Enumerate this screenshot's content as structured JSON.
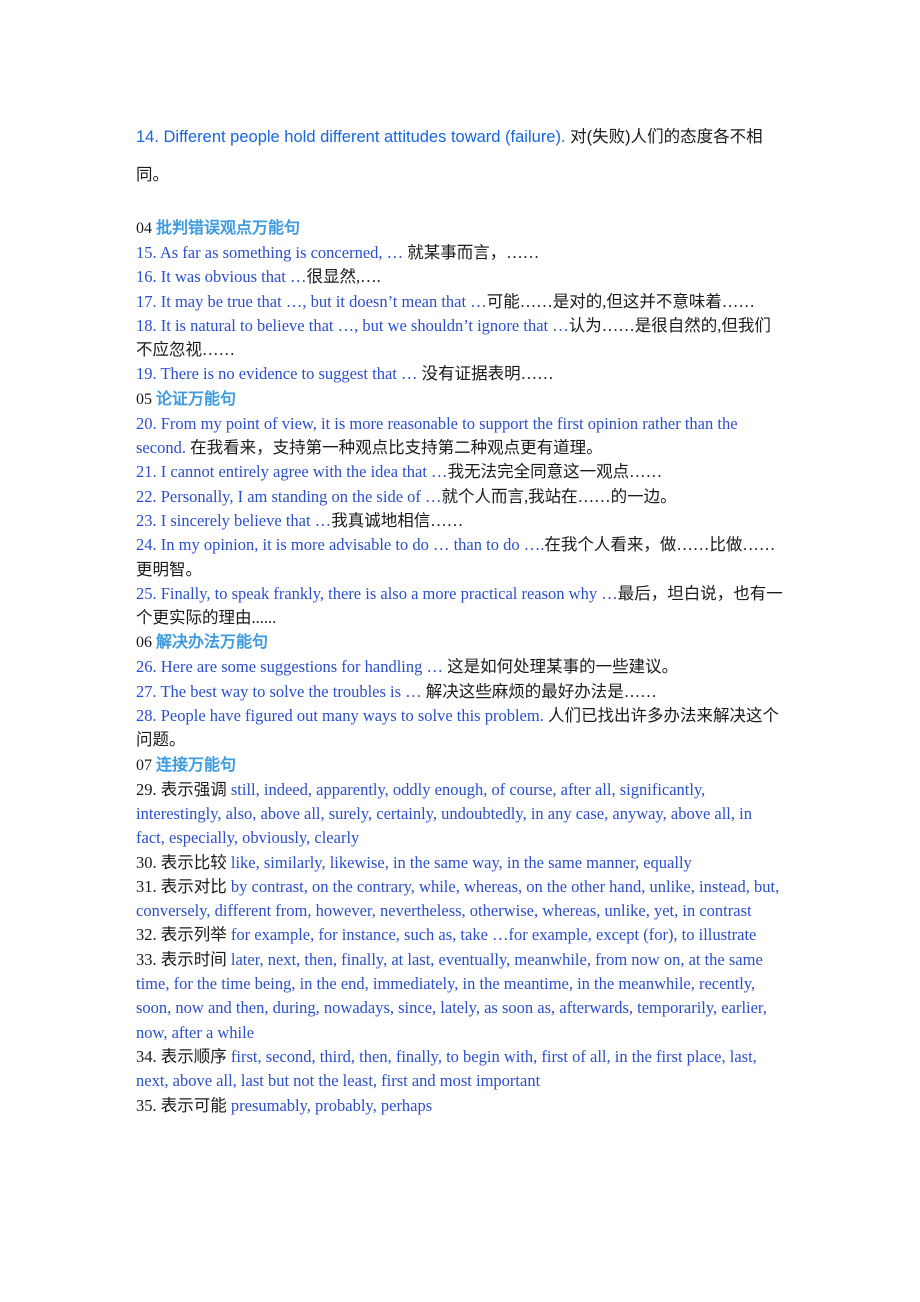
{
  "document": {
    "lead_entry": {
      "english": "14. Different people hold different attitudes toward (failure).",
      "chinese": " 对(失败)人们的态度各不相同。"
    },
    "sections": [
      {
        "number": "04",
        "title": "批判错误观点万能句",
        "entries": [
          {
            "type": "sentence",
            "english": "15. As far as something is concerned, …",
            "chinese": " 就某事而言，……"
          },
          {
            "type": "sentence",
            "english": "16. It was obvious that …",
            "chinese": "很显然,…."
          },
          {
            "type": "sentence",
            "english": "17. It may be true that …, but it doesn’t mean that …",
            "chinese": "可能……是对的,但这并不意味着……"
          },
          {
            "type": "sentence",
            "english": "18. It is natural to believe that …, but we shouldn’t ignore that …",
            "chinese": "认为……是很自然的,但我们不应忽视……"
          },
          {
            "type": "sentence",
            "english": "19. There is no evidence to suggest that …",
            "chinese": " 没有证据表明……"
          }
        ]
      },
      {
        "number": "05",
        "title": "论证万能句",
        "entries": [
          {
            "type": "sentence",
            "english": "20. From my point of view, it is more reasonable to support the first opinion rather than the second.",
            "chinese": " 在我看来，支持第一种观点比支持第二种观点更有道理。"
          },
          {
            "type": "sentence",
            "english": "21. I cannot entirely agree with the idea that …",
            "chinese": "我无法完全同意这一观点……"
          },
          {
            "type": "sentence",
            "english": "22. Personally, I am standing on the side of …",
            "chinese": "就个人而言,我站在……的一边。"
          },
          {
            "type": "sentence",
            "english": "23. I sincerely believe that …",
            "chinese": "我真诚地相信……"
          },
          {
            "type": "sentence",
            "english": "24. In my opinion, it is more advisable to do … than to do ….",
            "chinese": "在我个人看来，做……比做……更明智。"
          },
          {
            "type": "sentence",
            "english": "25. Finally, to speak frankly, there is also a more practical reason why …",
            "chinese": "最后，坦白说，也有一个更实际的理由......"
          }
        ]
      },
      {
        "number": "06",
        "title": "解决办法万能句",
        "entries": [
          {
            "type": "sentence",
            "english": "26. Here are some suggestions for handling …",
            "chinese": " 这是如何处理某事的一些建议。"
          },
          {
            "type": "sentence",
            "english": "27. The best way to solve the troubles is …",
            "chinese": " 解决这些麻烦的最好办法是……"
          },
          {
            "type": "sentence",
            "english": "28. People have figured out many ways to solve this problem.",
            "chinese": " 人们已找出许多办法来解决这个问题。"
          }
        ]
      },
      {
        "number": "07",
        "title": "连接万能句",
        "entries": [
          {
            "type": "connector",
            "label": "29. 表示强调",
            "list": " still, indeed, apparently, oddly enough, of course, after all, significantly, interestingly, also, above all, surely, certainly, undoubtedly, in any case, anyway, above all, in fact, especially, obviously, clearly"
          },
          {
            "type": "connector",
            "label": "30. 表示比较",
            "list": " like, similarly, likewise, in the same way, in the same manner, equally"
          },
          {
            "type": "connector",
            "label": "31. 表示对比",
            "list": " by contrast, on the contrary, while, whereas, on the other hand, unlike, instead, but, conversely, different from, however, nevertheless, otherwise, whereas, unlike, yet, in contrast"
          },
          {
            "type": "connector",
            "label": "32. 表示列举",
            "list": " for example, for instance, such as, take …for example, except (for), to illustrate"
          },
          {
            "type": "connector",
            "label": "33. 表示时间",
            "list": " later, next, then, finally, at last, eventually, meanwhile, from now on, at the same time, for the time being, in the end, immediately, in the meantime, in the meanwhile, recently, soon, now and then, during, nowadays, since, lately, as soon as, afterwards, temporarily, earlier, now, after a while"
          },
          {
            "type": "connector",
            "label": "34. 表示顺序",
            "list": " first, second, third, then, finally, to begin with, first of all, in the first place, last, next, above all, last but not the least, first and most important"
          },
          {
            "type": "connector",
            "label": "35. 表示可能",
            "list": " presumably, probably, perhaps"
          }
        ]
      }
    ]
  }
}
